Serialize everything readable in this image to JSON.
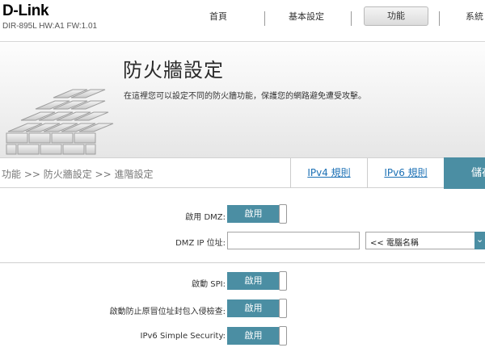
{
  "brand": {
    "logo": "D-Link",
    "model_info": "DIR-895L HW:A1 FW:1.01"
  },
  "nav": {
    "home": "首頁",
    "basic_settings": "基本設定",
    "features": "功能",
    "system": "系統"
  },
  "banner": {
    "title": "防火牆設定",
    "description": "在這裡您可以設定不同的防火牆功能，保護您的網路避免遭受攻擊。"
  },
  "breadcrumb": "功能 >> 防火牆設定 >> 進階設定",
  "tabs": {
    "ipv4_rules": "IPv4 規則",
    "ipv6_rules": "IPv6 規則",
    "save": "儲存"
  },
  "form": {
    "enable_dmz": {
      "label": "啟用 DMZ:",
      "state": "啟用"
    },
    "dmz_ip": {
      "label": "DMZ IP 位址:",
      "value": "",
      "select_value": "<< 電腦名稱"
    },
    "spi": {
      "label": "啟動 SPI:",
      "state": "啟用"
    },
    "anti_spoof": {
      "label": "啟動防止原冒位址封包入侵檢查:",
      "state": "啟用"
    },
    "ipv6_security": {
      "label": "IPv6 Simple Security:",
      "state": "啟用"
    }
  },
  "colors": {
    "accent": "#4b8ea3",
    "link": "#1b70b5"
  },
  "icons": {
    "banner": "brick-wall-icon",
    "dropdown": "chevron-down-icon"
  }
}
